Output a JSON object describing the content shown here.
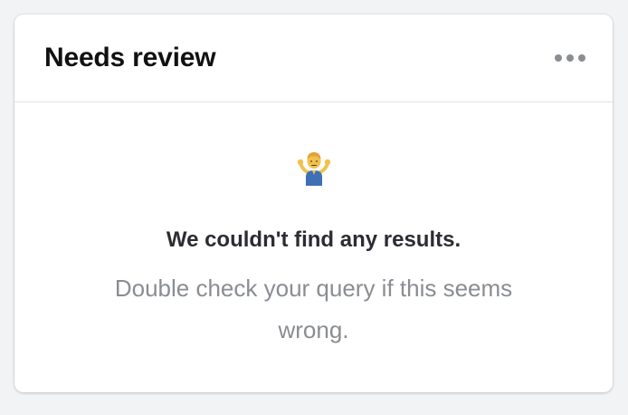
{
  "card": {
    "title": "Needs review",
    "menu_icon": "more-horizontal-icon"
  },
  "empty_state": {
    "icon": "person-shrugging-icon",
    "title": "We couldn't find any results.",
    "description": "Double check your query if this seems wrong."
  },
  "colors": {
    "background": "#f2f3f5",
    "card": "#ffffff",
    "title_text": "#111111",
    "muted_text": "#8a8d91",
    "divider": "#e3e4e6"
  }
}
